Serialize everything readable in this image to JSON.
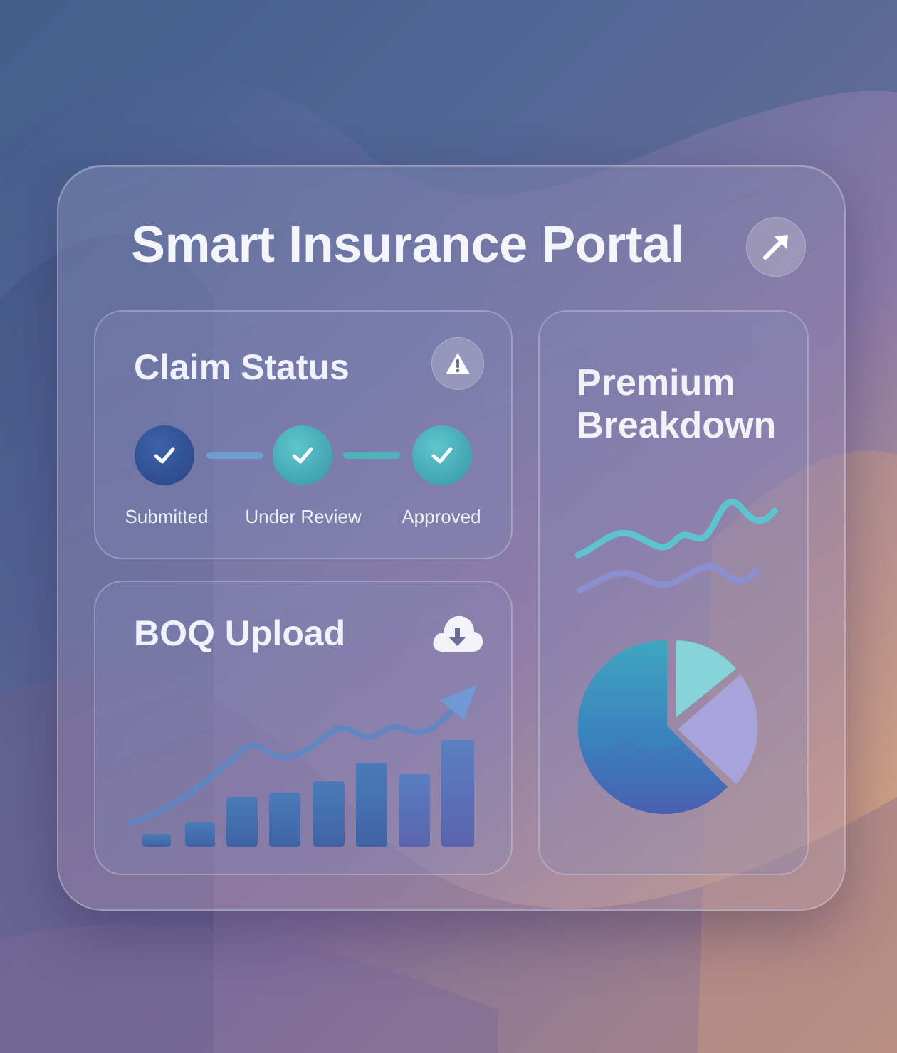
{
  "header": {
    "title": "Smart Insurance Portal",
    "action_icon": "arrow-up-right-icon"
  },
  "claim_status": {
    "title": "Claim Status",
    "alert_icon": "warning-icon",
    "steps": [
      {
        "label": "Submitted",
        "completed": true,
        "color": "#2f4f95"
      },
      {
        "label": "Under Review",
        "completed": true,
        "color": "#3aa7b0"
      },
      {
        "label": "Approved",
        "completed": true,
        "color": "#3aa7b0"
      }
    ]
  },
  "boq_upload": {
    "title": "BOQ Upload",
    "upload_icon": "cloud-download-icon"
  },
  "premium_breakdown": {
    "title_line1": "Premium",
    "title_line2": "Breakdown"
  },
  "colors": {
    "accent_teal": "#5cc3cf",
    "accent_blue": "#3a6fb3",
    "accent_lavender": "#a9a3db"
  }
}
